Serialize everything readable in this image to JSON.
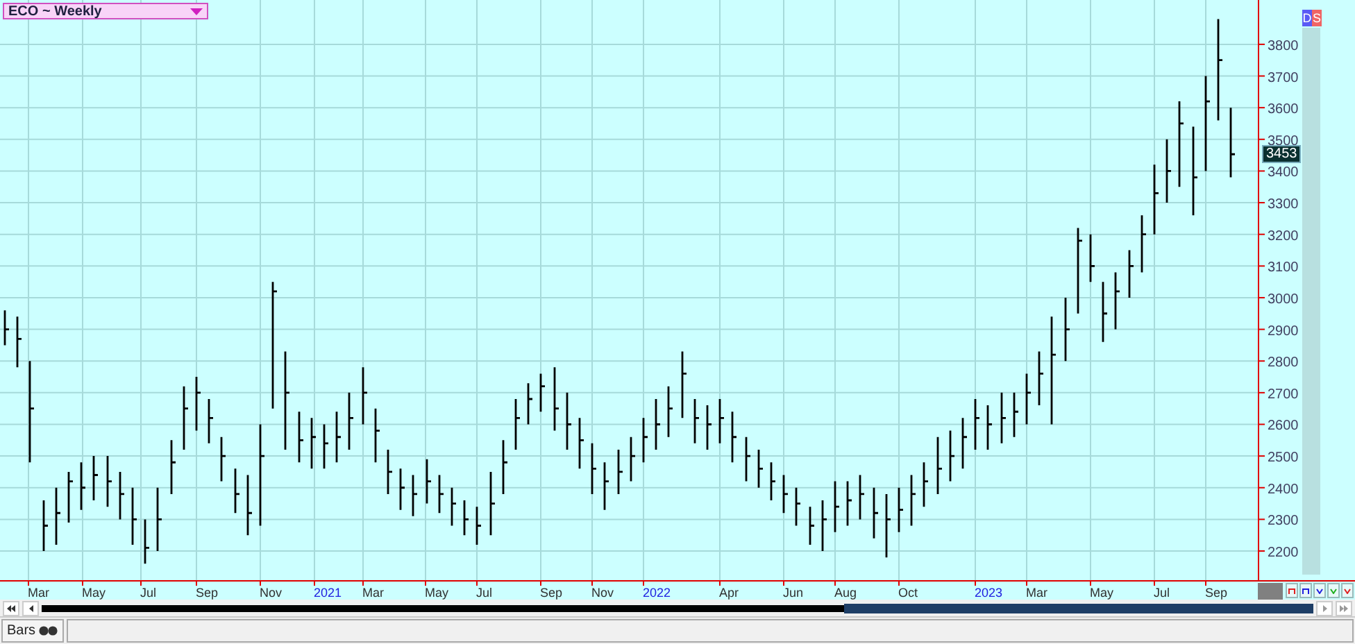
{
  "legend": {
    "title": "ECO ~ Weekly"
  },
  "badges": [
    {
      "label": "D",
      "color": "#5a5af5"
    },
    {
      "label": "S",
      "color": "#f06464"
    }
  ],
  "price_tag": "3453",
  "y_axis": {
    "labels": [
      "3800",
      "3700",
      "3600",
      "3500",
      "3400",
      "3300",
      "3200",
      "3100",
      "3000",
      "2900",
      "2800",
      "2700",
      "2600",
      "2500",
      "2400",
      "2300",
      "2200"
    ]
  },
  "x_axis": {
    "labels": [
      {
        "text": "Mar",
        "kind": "month"
      },
      {
        "text": "May",
        "kind": "month"
      },
      {
        "text": "Jul",
        "kind": "month"
      },
      {
        "text": "Sep",
        "kind": "month"
      },
      {
        "text": "Nov",
        "kind": "month"
      },
      {
        "text": "2021",
        "kind": "year"
      },
      {
        "text": "Mar",
        "kind": "month"
      },
      {
        "text": "May",
        "kind": "month"
      },
      {
        "text": "Jul",
        "kind": "month"
      },
      {
        "text": "Sep",
        "kind": "month"
      },
      {
        "text": "Nov",
        "kind": "month"
      },
      {
        "text": "2022",
        "kind": "year"
      },
      {
        "text": "Apr",
        "kind": "month"
      },
      {
        "text": "Jun",
        "kind": "month"
      },
      {
        "text": "Aug",
        "kind": "month"
      },
      {
        "text": "Oct",
        "kind": "month"
      },
      {
        "text": "2023",
        "kind": "year"
      },
      {
        "text": "Mar",
        "kind": "month"
      },
      {
        "text": "May",
        "kind": "month"
      },
      {
        "text": "Jul",
        "kind": "month"
      },
      {
        "text": "Sep",
        "kind": "month"
      }
    ]
  },
  "status_bar": {
    "tab": "Bars"
  }
}
